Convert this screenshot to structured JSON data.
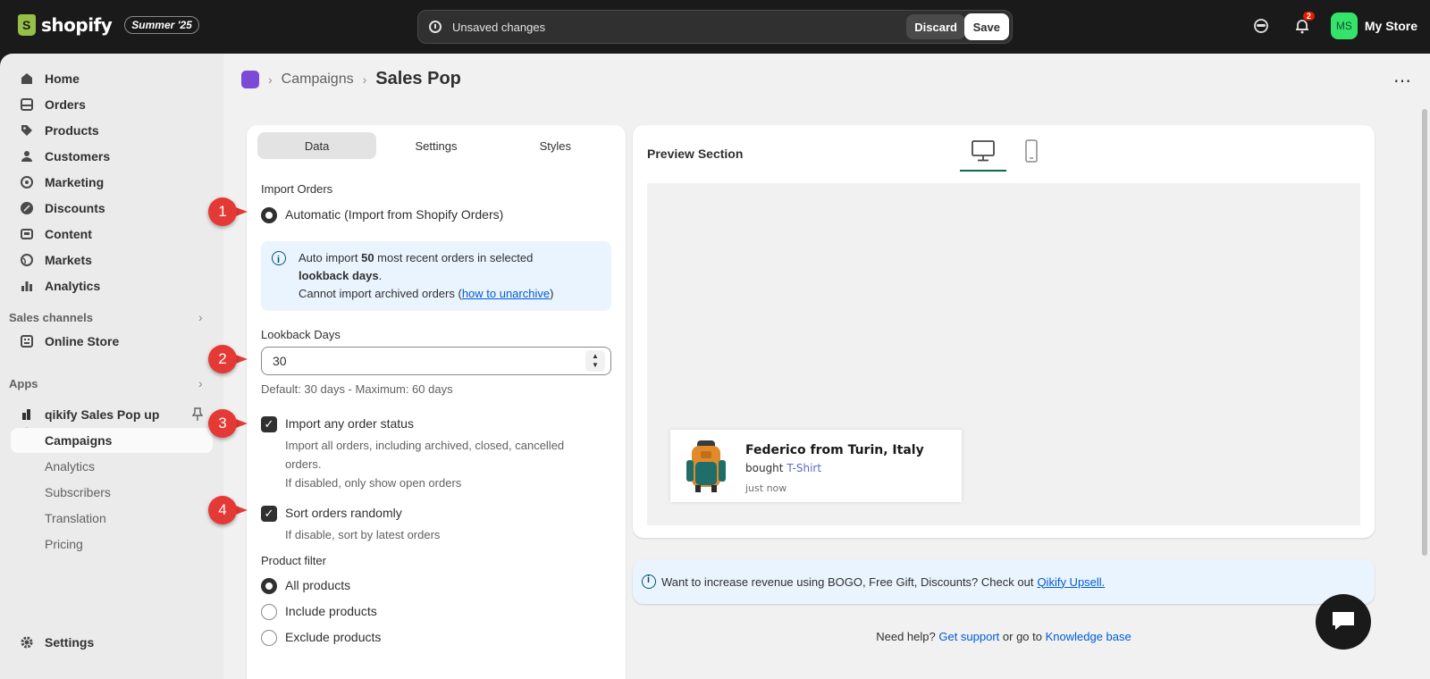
{
  "topbar": {
    "logo_text": "shopify",
    "edition": "Summer '25",
    "unsaved_text": "Unsaved changes",
    "discard_label": "Discard",
    "save_label": "Save",
    "notification_count": "2",
    "avatar_initials": "MS",
    "store_name": "My Store"
  },
  "sidebar": {
    "items": [
      {
        "label": "Home",
        "icon": "home-icon"
      },
      {
        "label": "Orders",
        "icon": "orders-icon"
      },
      {
        "label": "Products",
        "icon": "tag-icon"
      },
      {
        "label": "Customers",
        "icon": "person-icon"
      },
      {
        "label": "Marketing",
        "icon": "target-icon"
      },
      {
        "label": "Discounts",
        "icon": "discount-icon"
      },
      {
        "label": "Content",
        "icon": "content-icon"
      },
      {
        "label": "Markets",
        "icon": "globe-icon"
      },
      {
        "label": "Analytics",
        "icon": "bar-chart-icon"
      }
    ],
    "sales_channels_label": "Sales channels",
    "online_store_label": "Online Store",
    "apps_label": "Apps",
    "app_name": "qikify Sales Pop up",
    "app_subitems": [
      "Campaigns",
      "Analytics",
      "Subscribers",
      "Translation",
      "Pricing"
    ],
    "settings_label": "Settings"
  },
  "breadcrumb": {
    "parent": "Campaigns",
    "current": "Sales Pop"
  },
  "tabs": [
    "Data",
    "Settings",
    "Styles"
  ],
  "form": {
    "import_orders_label": "Import Orders",
    "import_option": "Automatic (Import from Shopify Orders)",
    "info": {
      "line1_pre": "Auto import ",
      "line1_bold": "50",
      "line1_post": " most recent orders in selected",
      "line2_bold": "lookback days",
      "line2_post": ".",
      "line3_pre": "Cannot import archived orders (",
      "line3_link": "how to unarchive",
      "line3_post": ")"
    },
    "lookback_label": "Lookback Days",
    "lookback_value": "30",
    "lookback_help": "Default: 30 days - Maximum: 60 days",
    "any_status_label": "Import any order status",
    "any_status_help1": "Import all orders, including archived, closed, cancelled",
    "any_status_help2": "orders.",
    "any_status_help3": "If disabled, only show open orders",
    "random_label": "Sort orders randomly",
    "random_help": "If disable, sort by latest orders",
    "product_filter_label": "Product filter",
    "product_filter_options": [
      "All products",
      "Include products",
      "Exclude products"
    ]
  },
  "annotations": [
    "1",
    "2",
    "3",
    "4"
  ],
  "preview": {
    "title": "Preview Section",
    "popup_name": "Federico from Turin, Italy",
    "popup_bought_prefix": "bought ",
    "popup_product": "T-Shirt",
    "popup_time": "just now"
  },
  "promo": {
    "text": "Want to increase revenue using BOGO, Free Gift, Discounts? Check out",
    "link": "Qikify Upsell."
  },
  "help": {
    "prefix": "Need help? ",
    "support_link": "Get support",
    "middle": " or go to ",
    "kb_link": "Knowledge base"
  },
  "colors": {
    "accent_green": "#0f6b48",
    "annotation_red": "#e53935",
    "link_blue": "#005bd3"
  }
}
